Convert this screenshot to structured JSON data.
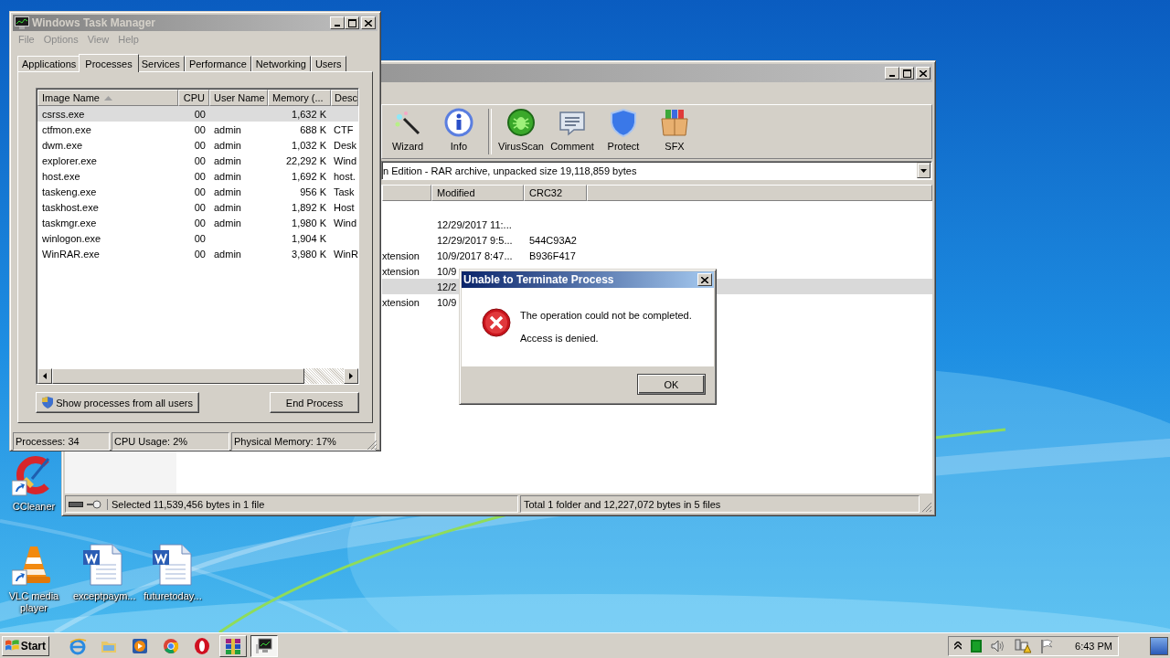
{
  "desktop_icons": [
    {
      "label": "CCleaner",
      "kind": "ccleaner",
      "shortcut": true
    },
    {
      "label": "VLC media player",
      "kind": "vlc",
      "shortcut": true
    },
    {
      "label": "exceptpaym...",
      "kind": "word",
      "shortcut": false
    },
    {
      "label": "futuretoday...",
      "kind": "word",
      "shortcut": false
    }
  ],
  "winrar": {
    "active": false,
    "toolbar": [
      {
        "label": "Wizard",
        "kind": "wizard"
      },
      {
        "label": "Info",
        "kind": "info"
      },
      {
        "label": "VirusScan",
        "kind": "virusscan"
      },
      {
        "label": "Comment",
        "kind": "comment"
      },
      {
        "label": "Protect",
        "kind": "protect"
      },
      {
        "label": "SFX",
        "kind": "sfx"
      }
    ],
    "path": "n Edition - RAR archive, unpacked size 19,118,859 bytes",
    "columns": [
      "Modified",
      "CRC32"
    ],
    "rows": [
      {
        "modified": "12/29/2017 11:...",
        "selected": false
      },
      {
        "modified": "12/29/2017 9:5...",
        "crc32": "544C93A2",
        "selected": false
      },
      {
        "type": "xtension",
        "modified": "10/9/2017 8:47...",
        "crc32": "B936F417",
        "selected": false
      },
      {
        "type": "xtension",
        "modified": "10/9",
        "selected": false
      },
      {
        "modified": "12/2",
        "selected": true
      },
      {
        "type": "xtension",
        "modified": "10/9",
        "selected": false
      }
    ],
    "status": [
      "Selected 11,539,456 bytes in 1 file",
      "Total 1 folder and 12,227,072 bytes in 5 files"
    ]
  },
  "task_manager": {
    "title": "Windows Task Manager",
    "active": false,
    "menu": [
      {
        "label": "File",
        "disabled": true
      },
      {
        "label": "Options",
        "disabled": true
      },
      {
        "label": "View",
        "disabled": true
      },
      {
        "label": "Help",
        "disabled": true
      }
    ],
    "tabs": [
      {
        "label": "Applications",
        "selected": false
      },
      {
        "label": "Processes",
        "selected": true
      },
      {
        "label": "Services",
        "selected": false
      },
      {
        "label": "Performance",
        "selected": false
      },
      {
        "label": "Networking",
        "selected": false
      },
      {
        "label": "Users",
        "selected": false
      }
    ],
    "columns": [
      {
        "label": "Image Name",
        "sorted": true
      },
      {
        "label": "CPU",
        "sorted": false
      },
      {
        "label": "User Name",
        "sorted": false
      },
      {
        "label": "Memory (...",
        "sorted": false
      },
      {
        "label": "Desc",
        "sorted": false
      }
    ],
    "rows": [
      {
        "name": "csrss.exe",
        "cpu": "00",
        "memory": "1,632 K",
        "selected": true
      },
      {
        "name": "ctfmon.exe",
        "cpu": "00",
        "user": "admin",
        "memory": "688 K",
        "desc": "CTF",
        "selected": false
      },
      {
        "name": "dwm.exe",
        "cpu": "00",
        "user": "admin",
        "memory": "1,032 K",
        "desc": "Desk",
        "selected": false
      },
      {
        "name": "explorer.exe",
        "cpu": "00",
        "user": "admin",
        "memory": "22,292 K",
        "desc": "Wind",
        "selected": false
      },
      {
        "name": "host.exe",
        "cpu": "00",
        "user": "admin",
        "memory": "1,692 K",
        "desc": "host.",
        "selected": false
      },
      {
        "name": "taskeng.exe",
        "cpu": "00",
        "user": "admin",
        "memory": "956 K",
        "desc": "Task",
        "selected": false
      },
      {
        "name": "taskhost.exe",
        "cpu": "00",
        "user": "admin",
        "memory": "1,892 K",
        "desc": "Host",
        "selected": false
      },
      {
        "name": "taskmgr.exe",
        "cpu": "00",
        "user": "admin",
        "memory": "1,980 K",
        "desc": "Wind",
        "selected": false
      },
      {
        "name": "winlogon.exe",
        "cpu": "00",
        "memory": "1,904 K",
        "selected": false
      },
      {
        "name": "WinRAR.exe",
        "cpu": "00",
        "user": "admin",
        "memory": "3,980 K",
        "desc": "WinR",
        "selected": false
      }
    ],
    "show_all_button": "Show processes from all users",
    "end_button": "End Process",
    "status": [
      "Processes: 34",
      "CPU Usage: 2%",
      "Physical Memory: 17%"
    ]
  },
  "dialog": {
    "title": "Unable to Terminate Process",
    "active": true,
    "messages": [
      "The operation could not be completed.",
      "Access is denied."
    ],
    "button": "OK"
  },
  "taskbar": {
    "start": "Start",
    "buttons": [
      {
        "kind": "ie",
        "running": false,
        "selected": false
      },
      {
        "kind": "explorer",
        "running": false,
        "selected": false
      },
      {
        "kind": "media",
        "running": false,
        "selected": false
      },
      {
        "kind": "chrome",
        "running": false,
        "selected": false
      },
      {
        "kind": "opera",
        "running": false,
        "selected": false
      },
      {
        "kind": "winrar",
        "running": true,
        "selected": false
      },
      {
        "kind": "taskmgr",
        "running": true,
        "selected": true
      }
    ],
    "tray": [
      {
        "kind": "chevron"
      },
      {
        "kind": "square"
      },
      {
        "kind": "speaker"
      },
      {
        "kind": "network"
      },
      {
        "kind": "flag"
      }
    ],
    "clock": "6:43 PM"
  }
}
